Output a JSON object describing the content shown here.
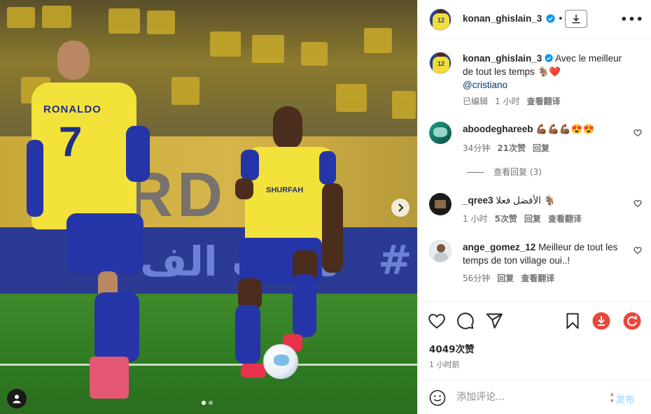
{
  "post": {
    "username": "konan_ghislain_3",
    "download_label": "download",
    "more_label": "•••",
    "bullet": "•"
  },
  "photo": {
    "jersey_name": "RONALDO",
    "jersey_number": "7",
    "sponsor": "SHURFAH",
    "board_letters": "NARD",
    "led_text": "ملعب الف",
    "led_hash": "#",
    "carousel": {
      "total": 2,
      "active": 1
    }
  },
  "caption": {
    "username": "konan_ghislain_3",
    "text": "Avec le meilleur de tout les temps",
    "emojis": "🐐❤️",
    "mention": "@cristiano",
    "edited": "已编辑",
    "time": "1 小时",
    "translate": "查看翻译"
  },
  "comments": [
    {
      "username": "aboodeghareeb",
      "text": "💪🏾💪🏾💪🏾😍😍",
      "time": "34分钟",
      "likes": "21次赞",
      "reply": "回复"
    },
    {
      "username": "_qree3",
      "text": "الأفضل فعلا 🐐",
      "time": "1 小时",
      "likes": "5次赞",
      "reply": "回复",
      "translate": "查看翻译"
    },
    {
      "username": "ange_gomez_12",
      "text": "Meilleur de tout les temps de ton village oui..!",
      "time": "56分钟",
      "reply": "回复",
      "translate": "查看翻译"
    }
  ],
  "view_replies": "查看回复 (3)",
  "actions": {
    "likes": "4049次赞",
    "time_ago": "1 小时前"
  },
  "composer": {
    "placeholder": "添加评论...",
    "post_label": "发布"
  },
  "colors": {
    "verified": "#0095f6",
    "red_heart": "#ed4956",
    "download_red": "#e8473c",
    "mention": "#00376b"
  }
}
